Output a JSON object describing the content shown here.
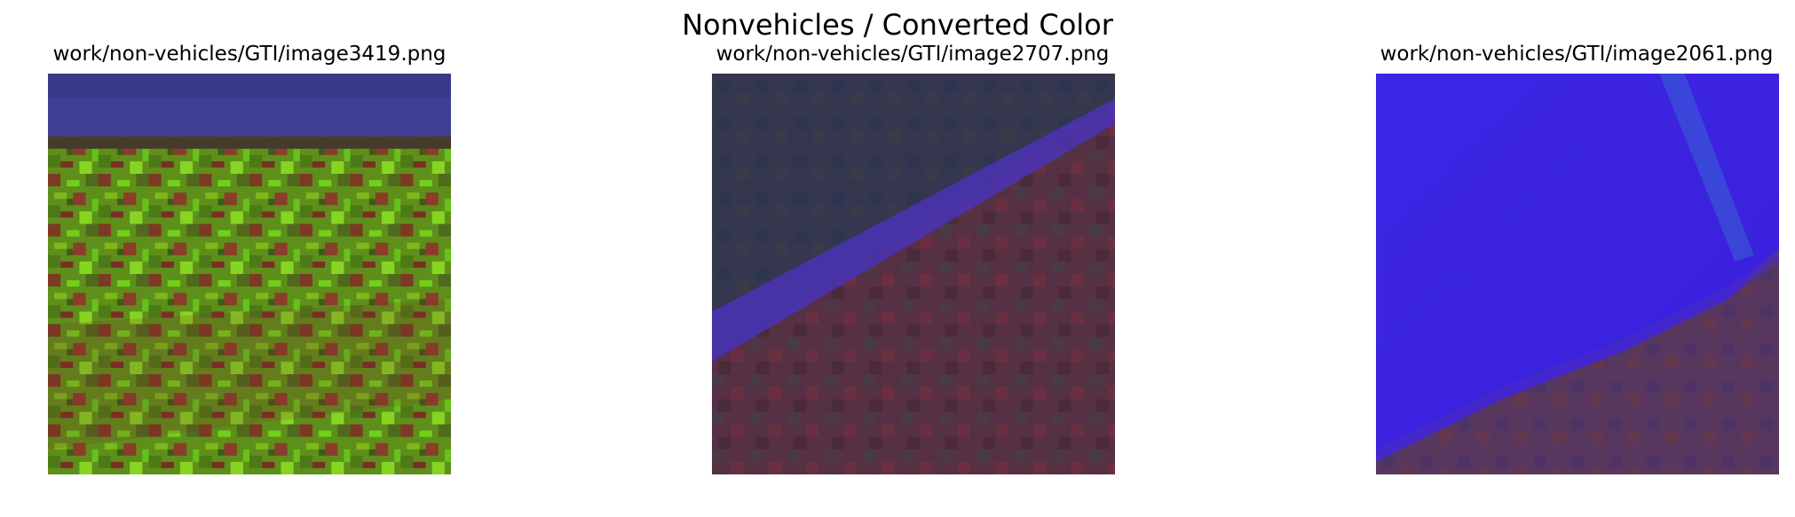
{
  "figure": {
    "title": "Nonvehicles / Converted Color"
  },
  "panels": [
    {
      "title": "work/non-vehicles/GTI/image3419.png",
      "colors": {
        "top_band": "#3f3f96",
        "bottom": "#5d8c1a"
      }
    },
    {
      "title": "work/non-vehicles/GTI/image2707.png",
      "colors": {
        "upper": "#33364d",
        "edge": "#4a32b6",
        "lower": "#532f40"
      }
    },
    {
      "title": "work/non-vehicles/GTI/image2061.png",
      "colors": {
        "upper": "#3d23ec",
        "lower": "#57365e"
      }
    }
  ]
}
